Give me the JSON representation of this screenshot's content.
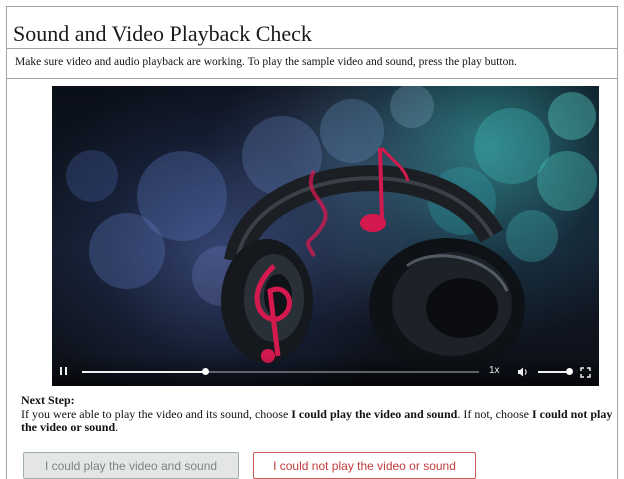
{
  "page": {
    "title": "Sound and Video Playback Check",
    "description": "Make sure video and audio playback are working. To play the sample video and sound, press the play button."
  },
  "player": {
    "progress_fraction": 0.31,
    "volume_fraction": 1.0,
    "playback_state": "playing",
    "speed_label": "1x",
    "icons": {
      "pause": "pause-icon",
      "volume": "volume-icon",
      "fullscreen": "fullscreen-icon"
    }
  },
  "next_step": {
    "heading": "Next Step:",
    "text_1": "If you were able to play the video and its sound, choose ",
    "bold_1": "I could play the video and sound",
    "text_2": ". If not, choose ",
    "bold_2": "I could not play the video or sound",
    "text_3": "."
  },
  "buttons": {
    "yes_label": "I could play the video and sound",
    "no_label": "I could not play the video or sound"
  },
  "colors": {
    "panel_border": "#9aa6a0",
    "yes_button_bg": "#e3e6e4",
    "no_button_border": "#c95a5a",
    "music_note": "#d4194f"
  }
}
